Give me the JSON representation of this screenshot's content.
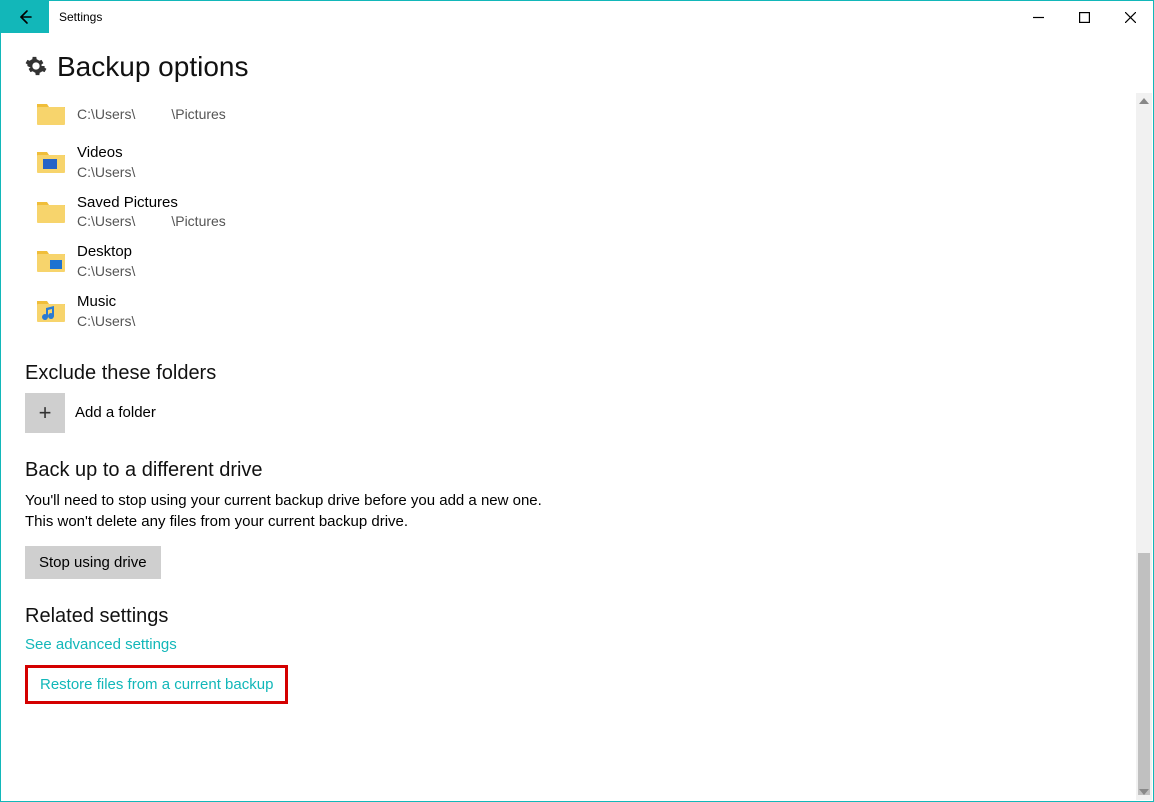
{
  "window": {
    "title": "Settings"
  },
  "page": {
    "title": "Backup options"
  },
  "folders": [
    {
      "name": "",
      "path_prefix": "C:\\Users\\",
      "path_suffix": "\\Pictures",
      "icon": "folder-pictures"
    },
    {
      "name": "Videos",
      "path_prefix": "C:\\Users\\",
      "path_suffix": "",
      "icon": "folder-videos"
    },
    {
      "name": "Saved Pictures",
      "path_prefix": "C:\\Users\\",
      "path_suffix": "\\Pictures",
      "icon": "folder-pictures"
    },
    {
      "name": "Desktop",
      "path_prefix": "C:\\Users\\",
      "path_suffix": "",
      "icon": "folder-desktop"
    },
    {
      "name": "Music",
      "path_prefix": "C:\\Users\\",
      "path_suffix": "",
      "icon": "folder-music"
    }
  ],
  "exclude": {
    "heading": "Exclude these folders",
    "add_label": "Add a folder"
  },
  "different_drive": {
    "heading": "Back up to a different drive",
    "body": "You'll need to stop using your current backup drive before you add a new one. This won't delete any files from your current backup drive.",
    "button": "Stop using drive"
  },
  "related": {
    "heading": "Related settings",
    "advanced_link": "See advanced settings",
    "restore_link": "Restore files from a current backup"
  }
}
